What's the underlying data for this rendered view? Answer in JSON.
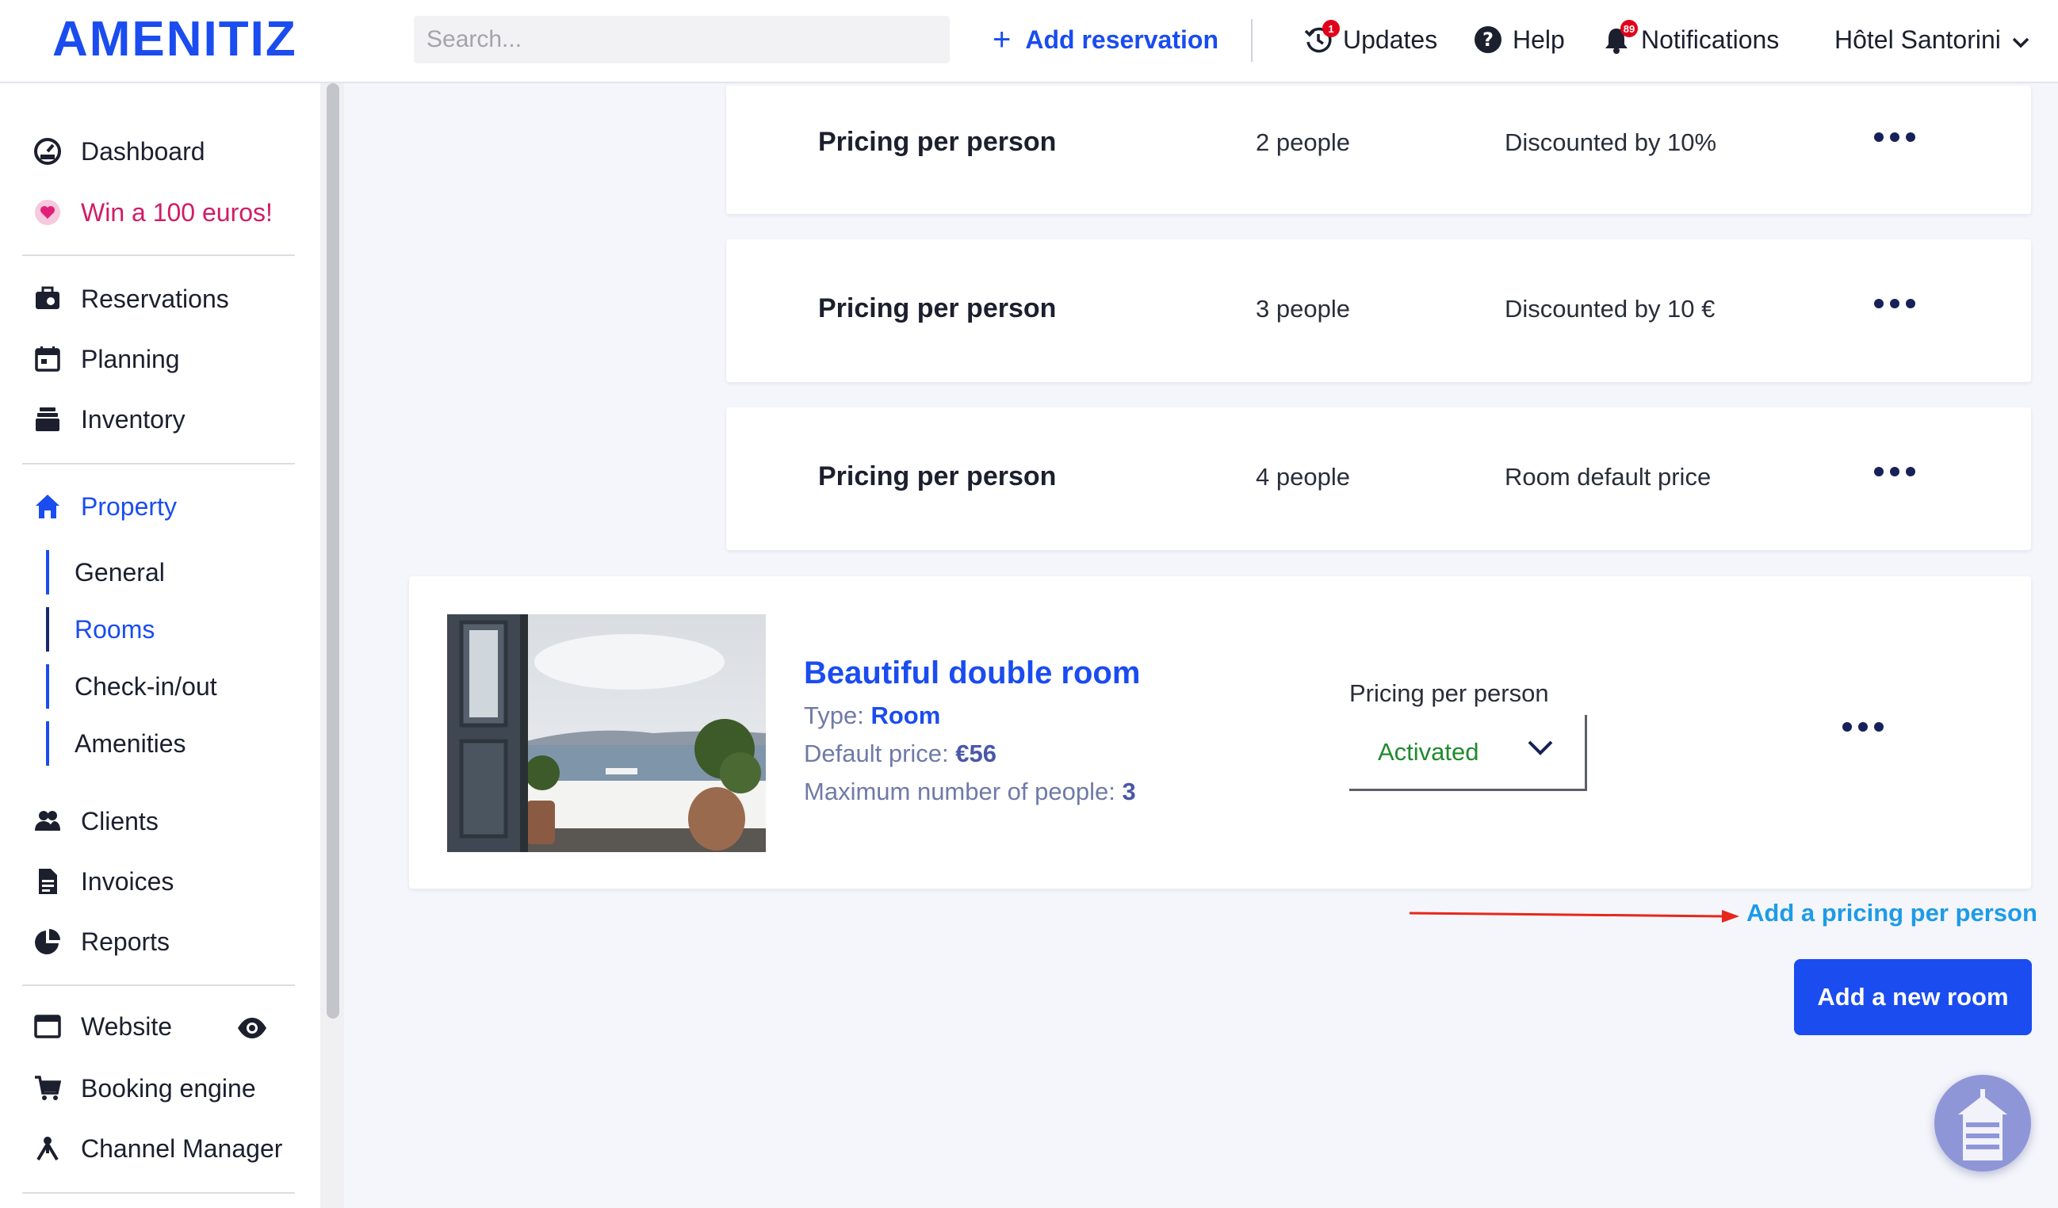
{
  "brand": {
    "logo": "AMENITIZ",
    "accent_color": "#1a4cf0"
  },
  "topbar": {
    "search_placeholder": "Search...",
    "add_reservation": "Add reservation",
    "updates": {
      "label": "Updates",
      "badge": "1",
      "icon": "clock-history-icon"
    },
    "help": {
      "label": "Help",
      "icon": "question-circle-icon"
    },
    "notifications": {
      "label": "Notifications",
      "badge": "89",
      "icon": "bell-icon"
    },
    "hotel": "Hôtel Santorini"
  },
  "sidebar": {
    "dashboard": "Dashboard",
    "promo": "Win a 100 euros!",
    "reservations": "Reservations",
    "planning": "Planning",
    "inventory": "Inventory",
    "property": "Property",
    "property_sub": [
      "General",
      "Rooms",
      "Check-in/out",
      "Amenities"
    ],
    "clients": "Clients",
    "invoices": "Invoices",
    "reports": "Reports",
    "website": "Website",
    "booking_engine": "Booking engine",
    "channel_manager": "Channel Manager"
  },
  "pricing_rows": [
    {
      "label": "Pricing per person",
      "people": "2 people",
      "discount": "Discounted by 10%"
    },
    {
      "label": "Pricing per person",
      "people": "3 people",
      "discount": "Discounted by 10 €"
    },
    {
      "label": "Pricing per person",
      "people": "4 people",
      "discount": "Room default price"
    }
  ],
  "room": {
    "title": "Beautiful double room",
    "type_label": "Type:",
    "type_value": "Room",
    "price_label": "Default price:",
    "price_value": "€56",
    "max_label": "Maximum number of people:",
    "max_value": "3",
    "ppp_label": "Pricing per person",
    "ppp_value": "Activated",
    "ppp_value_color": "#1f8a2e"
  },
  "actions": {
    "add_pricing": "Add a pricing per person",
    "add_room": "Add a new room"
  }
}
